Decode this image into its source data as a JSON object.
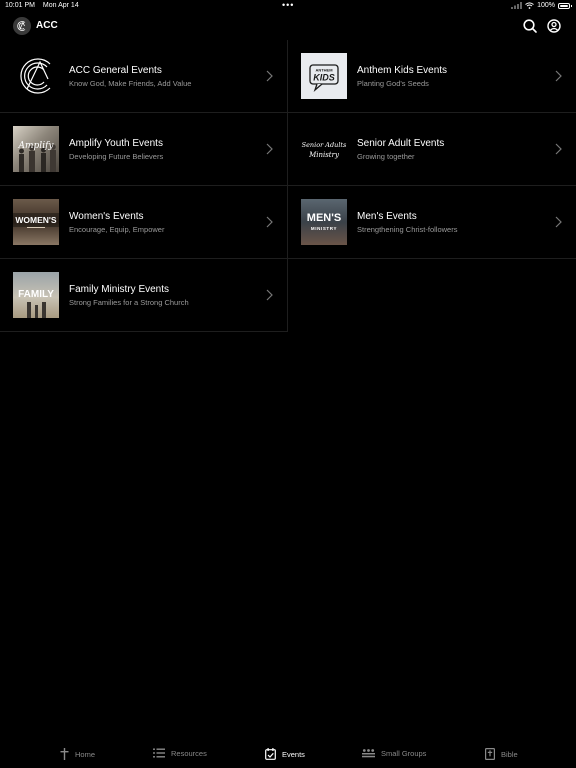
{
  "status": {
    "time": "10:01 PM",
    "date": "Mon Apr 14",
    "battery": "100%"
  },
  "header": {
    "app_name": "ACC"
  },
  "events": [
    {
      "title": "ACC General Events",
      "subtitle": "Know God, Make Friends, Add Value",
      "thumb_icon": "acc-logo-icon"
    },
    {
      "title": "Anthem Kids Events",
      "subtitle": "Planting God's Seeds",
      "thumb_icon": "anthem-kids-logo",
      "thumb_text": [
        "ANTHEM",
        "KIDS"
      ]
    },
    {
      "title": "Amplify Youth Events",
      "subtitle": "Developing Future Believers",
      "thumb_icon": "amplify-photo",
      "thumb_text": [
        "Amplify"
      ]
    },
    {
      "title": "Senior Adult Events",
      "subtitle": "Growing together",
      "thumb_icon": "senior-adults-logo",
      "thumb_text": [
        "Senior Adults",
        "Ministry"
      ]
    },
    {
      "title": "Women's Events",
      "subtitle": "Encourage, Equip, Empower",
      "thumb_icon": "womens-photo",
      "thumb_text": [
        "WOMEN'S"
      ]
    },
    {
      "title": "Men's Events",
      "subtitle": "Strengthening Christ-followers",
      "thumb_icon": "mens-photo",
      "thumb_text": [
        "MEN'S",
        "MINISTRY"
      ]
    },
    {
      "title": "Family Ministry Events",
      "subtitle": "Strong Families for a Strong Church",
      "thumb_icon": "family-photo",
      "thumb_text": [
        "FAMILY"
      ]
    }
  ],
  "tabs": [
    {
      "label": "Home",
      "icon": "cross-icon",
      "active": false
    },
    {
      "label": "Resources",
      "icon": "list-icon",
      "active": false
    },
    {
      "label": "Events",
      "icon": "calendar-check-icon",
      "active": true
    },
    {
      "label": "Small Groups",
      "icon": "groups-icon",
      "active": false
    },
    {
      "label": "Bible",
      "icon": "bible-icon",
      "active": false
    }
  ],
  "colors": {
    "background": "#000000",
    "text": "#ffffff",
    "subtitle": "#9a9a9a",
    "divider": "#1e1e1e",
    "tab_inactive": "#8a8a8a"
  }
}
